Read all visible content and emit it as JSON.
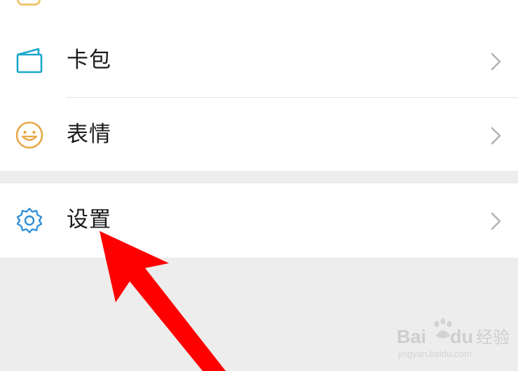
{
  "menu": {
    "items": [
      {
        "label": "卡包",
        "icon": "card-wallet-icon"
      },
      {
        "label": "表情",
        "icon": "smiley-face-icon"
      },
      {
        "label": "设置",
        "icon": "gear-icon"
      }
    ]
  },
  "watermark": {
    "text_latin_left": "Bai",
    "text_latin_right": "du",
    "text_cn": "经验",
    "url": "jingyan.baidu.com"
  },
  "colors": {
    "background": "#ededed",
    "surface": "#ffffff",
    "card_icon": "#1aa8c9",
    "smiley_icon": "#e8a94a",
    "gear_icon": "#2f8fd8",
    "arrow": "#ff0000",
    "chevron": "#b2b2b2"
  }
}
